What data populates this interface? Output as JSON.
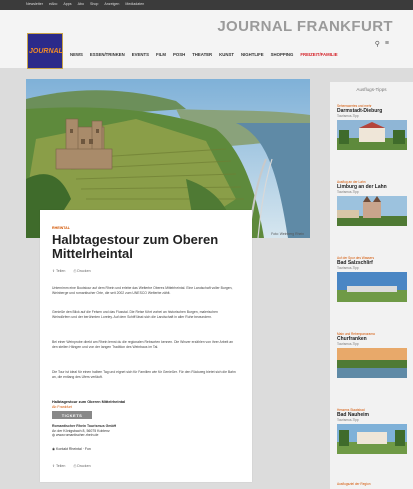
{
  "topbar": {
    "links": [
      "Newsletter",
      "eAbo",
      "Apps",
      "Abo",
      "Shop",
      "Anzeigen",
      "Mediadaten"
    ]
  },
  "header": {
    "brand": "JOURNAL FRANKFURT",
    "logo_text": "JOURNAL",
    "nav": [
      "NEWS",
      "ESSEN/TRINKEN",
      "EVENTS",
      "FILM",
      "POSH",
      "THEATER",
      "KUNST",
      "NIGHTLIFE",
      "SHOPPING",
      "FREIZEIT/FAMILIE"
    ],
    "active_nav": "FREIZEIT/FAMILIE"
  },
  "hero": {
    "credit": "Foto: Weinberg Rhein"
  },
  "article": {
    "category": "RHEINTAL",
    "title": "Halbtagestour zum Oberen Mittelrheintal",
    "share_label": "Teilen",
    "print_label": "Drucken",
    "paragraphs": [
      "Unternimm eine Bootstour auf dem Rhein und erlebe das Welterbe Oberes Mittelrheintal. Eine Landschaft voller Burgen, Weinberge und romantischer Orte, die seit 2002 zum UNESCO Welterbe zählt.",
      "Genieße den Blick auf die Felsen und das Flusstal. Die Reise führt vorbei an historischen Burgen, malerischen Weindörfern und der berühmten Loreley. Auf dem Schiff lässt sich die Landschaft in aller Ruhe bewundern.",
      "Bei einer Weinprobe direkt am Rhein lernst du die regionalen Rebsorten kennen. Die Winzer erzählen von ihrer Arbeit an den steilen Hängen und von der langen Tradition des Weinbaus im Tal.",
      "Die Tour ist ideal für einen halben Tag und eignet sich für Familien wie für Genießer. Für den Rückweg bietet sich die Bahn an, die entlang des Ufers verläuft."
    ],
    "info_title": "Halbtagestour zum Oberen Mittelrheintal",
    "info_date": "Ab Frankfurt",
    "tickets_label": "TICKETS",
    "address_lines": [
      "Romantischer Rhein Tourismus GmbH",
      "An der Königsbach 8, 56075 Koblenz",
      "www.romantischer-rhein.de"
    ],
    "contact": "Kontakt Rheintal · Fon",
    "share_label_bottom": "Teilen",
    "print_label_bottom": "Drucken"
  },
  "sidebar": {
    "title": "Ausflugs-Tipps",
    "tips": [
      {
        "category": "Sehenswertes und mehr",
        "name": "Darmstadt-Dieburg",
        "sub": "Tourismus-Tipp"
      },
      {
        "category": "Ausflug an der Lahn",
        "name": "Limburg an der Lahn",
        "sub": "Tourismus-Tipp"
      },
      {
        "category": "Auf der Spur des Wassers",
        "name": "Bad Salzschlirf",
        "sub": "Tourismus-Tipp"
      },
      {
        "category": "Main und Rebenpanorama",
        "name": "Churfranken",
        "sub": "Tourismus-Tipp"
      },
      {
        "category": "Hessens Staatsbad",
        "name": "Bad Nauheim",
        "sub": "Tourismus-Tipp"
      },
      {
        "category": "Ausflugsziel der Region",
        "name": "",
        "sub": ""
      }
    ]
  },
  "colors": {
    "accent": "#d35400",
    "nav_active": "#d41f26",
    "logo_bg": "#2b2a8a"
  },
  "icons": [
    "menu-icon",
    "search-icon",
    "share-icon",
    "print-icon",
    "phone-icon",
    "globe-icon"
  ]
}
